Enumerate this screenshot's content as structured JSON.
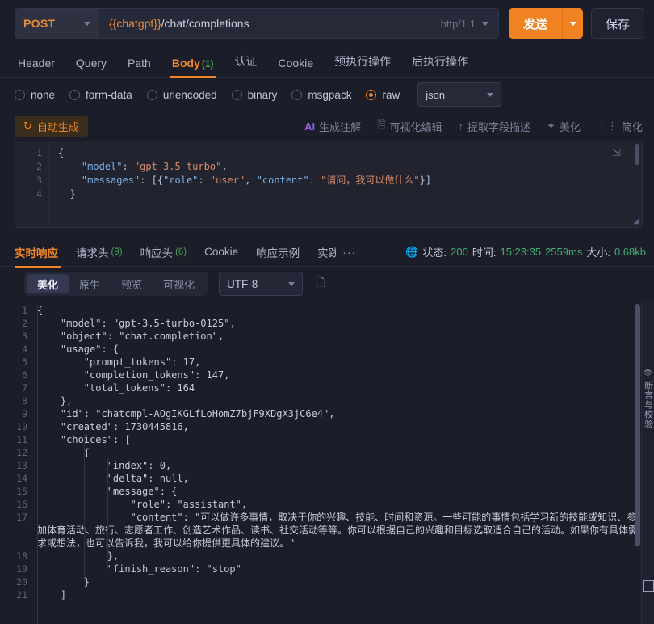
{
  "request_bar": {
    "method": "POST",
    "url_variable": "{{chatgpt}}",
    "url_path": "/chat/completions",
    "protocol": "http/1.1",
    "send_label": "发送",
    "save_label": "保存"
  },
  "request_tabs": [
    {
      "label": "Header",
      "count": "",
      "active": false
    },
    {
      "label": "Query",
      "count": "",
      "active": false
    },
    {
      "label": "Path",
      "count": "",
      "active": false
    },
    {
      "label": "Body",
      "count": "(1)",
      "active": true
    },
    {
      "label": "认证",
      "count": "",
      "active": false
    },
    {
      "label": "Cookie",
      "count": "",
      "active": false
    },
    {
      "label": "预执行操作",
      "count": "",
      "active": false
    },
    {
      "label": "后执行操作",
      "count": "",
      "active": false
    }
  ],
  "body_types": [
    {
      "label": "none",
      "selected": false
    },
    {
      "label": "form-data",
      "selected": false
    },
    {
      "label": "urlencoded",
      "selected": false
    },
    {
      "label": "binary",
      "selected": false
    },
    {
      "label": "msgpack",
      "selected": false
    },
    {
      "label": "raw",
      "selected": true
    }
  ],
  "format_select": {
    "value": "json"
  },
  "action_bar": {
    "autogen_label": "自动生成",
    "autogen_icon": "refresh-icon",
    "actions": [
      {
        "label": "生成注解",
        "icon": "ai-icon"
      },
      {
        "label": "可视化编辑",
        "icon": "edit-doc-icon"
      },
      {
        "label": "提取字段描述",
        "icon": "upload-icon"
      },
      {
        "label": "美化",
        "icon": "magic-wand-icon"
      },
      {
        "label": "简化",
        "icon": "list-collapse-icon"
      }
    ]
  },
  "request_editor": {
    "line_numbers": [
      "1",
      "2",
      "3",
      "4"
    ],
    "lines": [
      "{",
      "    \"model\": \"gpt-3.5-turbo\",",
      "    \"messages\": [{\"role\": \"user\", \"content\": \"请问，我可以做什么\"}]",
      "  }"
    ]
  },
  "response_tabs": [
    {
      "label": "实时响应",
      "count": "",
      "active": true
    },
    {
      "label": "请求头",
      "count": "(9)",
      "active": false
    },
    {
      "label": "响应头",
      "count": "(6)",
      "active": false
    },
    {
      "label": "Cookie",
      "count": "",
      "active": false
    },
    {
      "label": "响应示例",
      "count": "",
      "active": false
    },
    {
      "label": "实践",
      "count": "",
      "active": false
    }
  ],
  "response_tabs_overflow": "···",
  "status": {
    "globe_icon": "globe-icon",
    "status_label": "状态:",
    "status_value": "200",
    "time_label": "时间:",
    "time_value": "15:23:35",
    "duration_value": "2559ms",
    "size_label": "大小:",
    "size_value": "0.68kb"
  },
  "response_toolbar": {
    "segments": [
      {
        "label": "美化",
        "active": true
      },
      {
        "label": "原生",
        "active": false
      },
      {
        "label": "预览",
        "active": false
      },
      {
        "label": "可视化",
        "active": false
      }
    ],
    "encoding": "UTF-8",
    "copy_icon": "copy-icon"
  },
  "response_body": {
    "line_numbers": [
      "1",
      "2",
      "3",
      "4",
      "5",
      "6",
      "7",
      "8",
      "9",
      "10",
      "11",
      "12",
      "13",
      "14",
      "15",
      "16",
      "17",
      "18",
      "19",
      "20",
      "21"
    ],
    "lines": [
      "{",
      "    \"model\": \"gpt-3.5-turbo-0125\",",
      "    \"object\": \"chat.completion\",",
      "    \"usage\": {",
      "        \"prompt_tokens\": 17,",
      "        \"completion_tokens\": 147,",
      "        \"total_tokens\": 164",
      "    },",
      "    \"id\": \"chatcmpl-AOgIKGLfLoHomZ7bjF9XDgX3jC6e4\",",
      "    \"created\": 1730445816,",
      "    \"choices\": [",
      "        {",
      "            \"index\": 0,",
      "            \"delta\": null,",
      "            \"message\": {",
      "                \"role\": \"assistant\",",
      "                \"content\": \"可以做许多事情，取决于你的兴趣、技能、时间和资源。一些可能的事情包括学习新的技能或知识、参加体育活动、旅行、志愿者工作、创造艺术作品、读书、社交活动等等。你可以根据自己的兴趣和目标选取适合自己的活动。如果你有具体需求或想法，也可以告诉我，我可以给你提供更具体的建议。\"",
      "            },",
      "            \"finish_reason\": \"stop\"",
      "        }",
      "    ]"
    ]
  },
  "right_rail": {
    "eye_icon": "eye-icon",
    "vertical_label": "断言与校验",
    "grid_icon": "layout-grid-icon"
  },
  "colors": {
    "accent": "#f08221",
    "background": "#1b1d29",
    "panel": "#21242f",
    "success": "#3fae72",
    "text": "#c6cadb"
  }
}
